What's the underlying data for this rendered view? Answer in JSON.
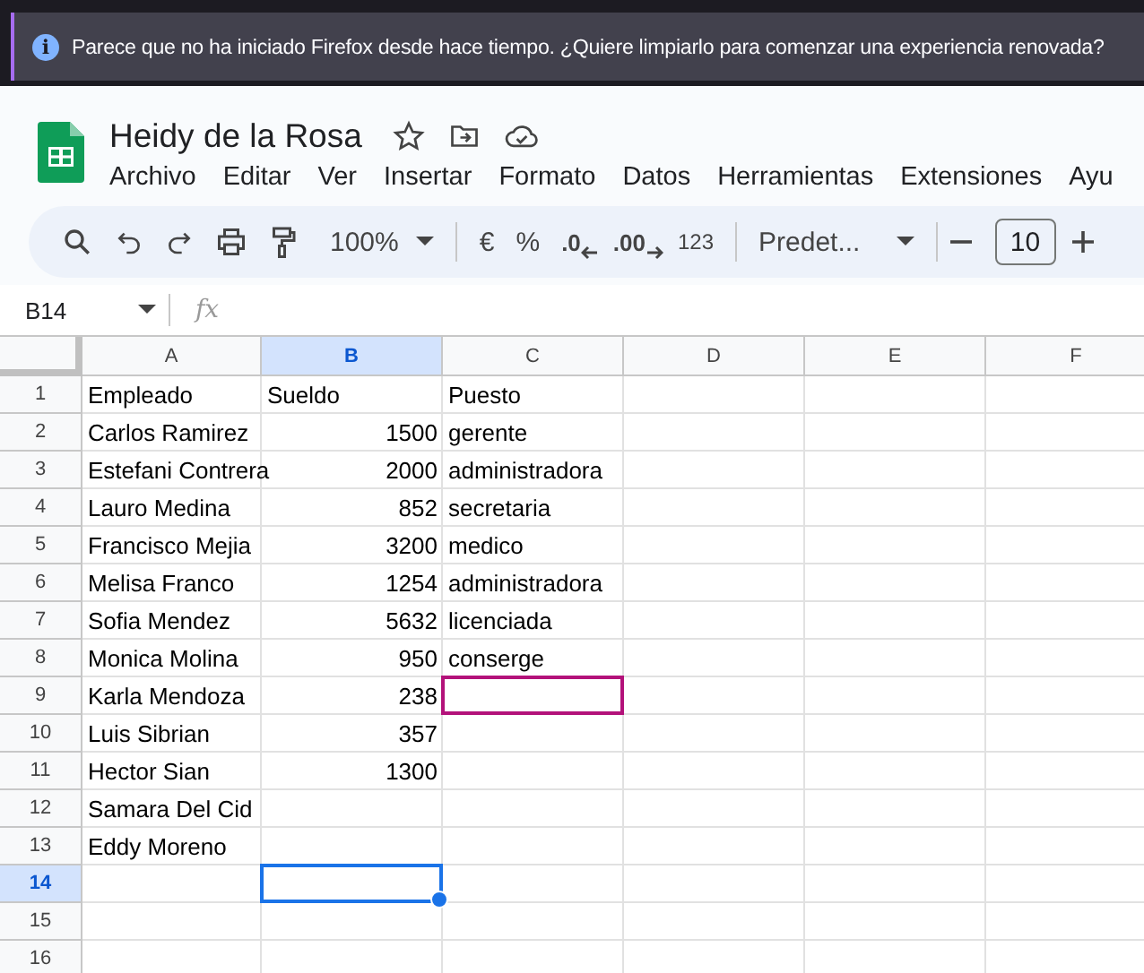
{
  "notification": {
    "icon": "i",
    "text": "Parece que no ha iniciado Firefox desde hace tiempo. ¿Quiere limpiarlo para comenzar una experiencia renovada?"
  },
  "document": {
    "title": "Heidy de la Rosa",
    "starred": false
  },
  "menu": [
    "Archivo",
    "Editar",
    "Ver",
    "Insertar",
    "Formato",
    "Datos",
    "Herramientas",
    "Extensiones",
    "Ayu"
  ],
  "toolbar": {
    "zoom": "100%",
    "currency": "€",
    "percent": "%",
    "decrease_decimals": ".0",
    "increase_decimals": ".00",
    "number_format": "123",
    "font": "Predet...",
    "font_size": "10"
  },
  "name_box": "B14",
  "formula": {
    "icon": "fx"
  },
  "columns": [
    {
      "label": "A",
      "selected": false,
      "collaborator_cursor": false
    },
    {
      "label": "B",
      "selected": true,
      "collaborator_cursor": false
    },
    {
      "label": "C",
      "selected": false,
      "collaborator_cursor": true
    },
    {
      "label": "D",
      "selected": false,
      "collaborator_cursor": false
    },
    {
      "label": "E",
      "selected": false,
      "collaborator_cursor": false
    },
    {
      "label": "F",
      "selected": false,
      "collaborator_cursor": false
    }
  ],
  "rows": [
    {
      "label": "1",
      "selected": false,
      "cells": [
        "Empleado",
        "Sueldo",
        "Puesto"
      ]
    },
    {
      "label": "2",
      "selected": false,
      "cells": [
        "Carlos Ramirez",
        "1500",
        "gerente"
      ]
    },
    {
      "label": "3",
      "selected": false,
      "cells": [
        "Estefani Contrera",
        "2000",
        "administradora"
      ]
    },
    {
      "label": "4",
      "selected": false,
      "cells": [
        "Lauro Medina",
        "852",
        "secretaria"
      ]
    },
    {
      "label": "5",
      "selected": false,
      "cells": [
        "Francisco Mejia",
        "3200",
        "medico"
      ]
    },
    {
      "label": "6",
      "selected": false,
      "cells": [
        "Melisa Franco",
        "1254",
        "administradora"
      ]
    },
    {
      "label": "7",
      "selected": false,
      "cells": [
        "Sofia Mendez",
        "5632",
        "licenciada"
      ]
    },
    {
      "label": "8",
      "selected": false,
      "cells": [
        "Monica Molina",
        "950",
        "conserge"
      ]
    },
    {
      "label": "9",
      "selected": false,
      "cells": [
        "Karla Mendoza",
        "238",
        ""
      ],
      "collaborator_cursor": true
    },
    {
      "label": "10",
      "selected": false,
      "cells": [
        "Luis Sibrian",
        "357",
        ""
      ]
    },
    {
      "label": "11",
      "selected": false,
      "cells": [
        "Hector Sian",
        "1300",
        ""
      ]
    },
    {
      "label": "12",
      "selected": false,
      "cells": [
        "Samara Del Cid",
        "",
        ""
      ]
    },
    {
      "label": "13",
      "selected": false,
      "cells": [
        "Eddy Moreno",
        "",
        ""
      ]
    },
    {
      "label": "14",
      "selected": true,
      "cells": [
        "",
        "",
        ""
      ]
    },
    {
      "label": "15",
      "selected": false,
      "cells": [
        "",
        "",
        ""
      ]
    },
    {
      "label": "16",
      "selected": false,
      "cells": [
        "",
        "",
        ""
      ]
    }
  ]
}
